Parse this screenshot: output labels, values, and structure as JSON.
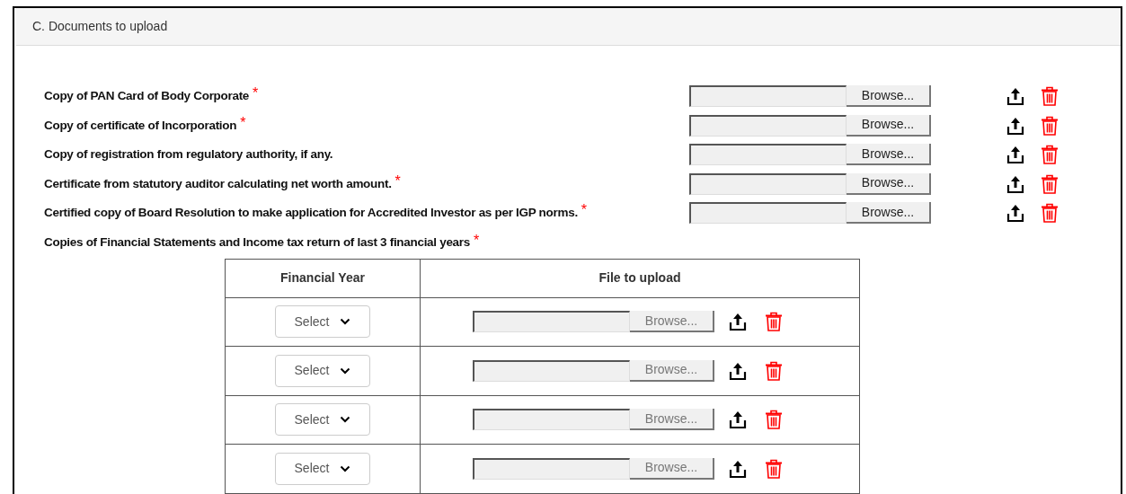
{
  "section": {
    "title": "C. Documents to upload"
  },
  "documents": [
    {
      "label": "Copy of PAN Card of Body Corporate",
      "required_mark": "*",
      "button": "Browse..."
    },
    {
      "label": "Copy of certificate of Incorporation",
      "required_mark": "*",
      "button": "Browse..."
    },
    {
      "label": "Copy of registration from regulatory authority, if any.",
      "button": "Browse..."
    },
    {
      "label": "Certificate from statutory auditor calculating net worth amount.",
      "required_mark": "*",
      "button": "Browse..."
    },
    {
      "label": "Certified copy of Board Resolution to make application for Accredited Investor as per IGP norms.",
      "required_mark": "*",
      "button": "Browse..."
    }
  ],
  "financials": {
    "label": "Copies of Financial Statements and Income tax return of last 3 financial years",
    "required_mark": "*",
    "table": {
      "columns": [
        "Financial Year",
        "File to upload"
      ],
      "rows": [
        {
          "year": "Select",
          "button": "Browse..."
        },
        {
          "year": "Select",
          "button": "Browse..."
        },
        {
          "year": "Select",
          "button": "Browse..."
        },
        {
          "year": "Select",
          "button": "Browse..."
        }
      ]
    }
  }
}
